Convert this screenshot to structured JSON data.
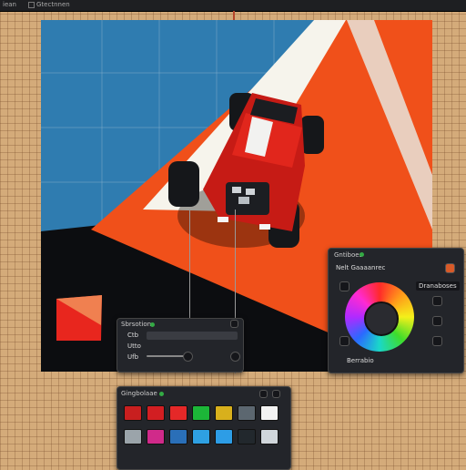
{
  "topbar": {
    "item1": "iean",
    "item2": "Gtectnnen"
  },
  "layers_panel": {
    "title": "Sbrsotion",
    "row1_label": "Ctb",
    "row2_label": "Utto",
    "row3_label": "Ufb"
  },
  "color_panel": {
    "title": "Gntiboes",
    "subtitle": "Nelt Gaaaanrec",
    "mode_label": "Dranaboses",
    "footer_label": "Berrabio"
  },
  "swatch_panel": {
    "title": "Gingbolaae",
    "colors": [
      "#c81f1f",
      "#d21e22",
      "#e52828",
      "#1cb638",
      "#d8b01c",
      "#5c6770",
      "#f2f2f2",
      "#9ba4aa",
      "#d02a8a",
      "#2a6fb8",
      "#2ea0e2",
      "#2d9de6",
      "#22282d",
      "#d0d6db"
    ]
  },
  "colors": {
    "canvas_blue": "#2f7cb0",
    "road_orange": "#f0501a",
    "car_red": "#e1261c"
  }
}
